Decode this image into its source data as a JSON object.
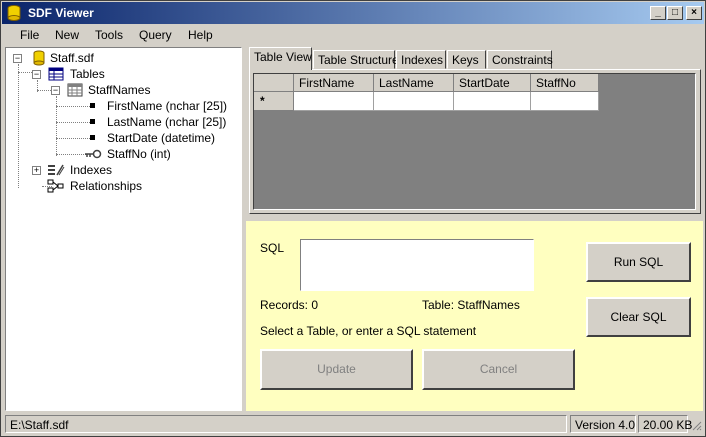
{
  "window": {
    "title": "SDF Viewer",
    "controls": {
      "minimize": "_",
      "maximize": "□",
      "close": "×"
    }
  },
  "menu": [
    "File",
    "New",
    "Tools",
    "Query",
    "Help"
  ],
  "tree": {
    "root": "Staff.sdf",
    "tables_label": "Tables",
    "table_name": "StaffNames",
    "columns": [
      "FirstName (nchar [25])",
      "LastName (nchar [25])",
      "StartDate (datetime)",
      "StaffNo (int)"
    ],
    "indexes_label": "Indexes",
    "relationships_label": "Relationships"
  },
  "tabs": [
    "Table View",
    "Table Structure",
    "Indexes",
    "Keys",
    "Constraints"
  ],
  "grid": {
    "columns": [
      "FirstName",
      "LastName",
      "StartDate",
      "StaffNo"
    ],
    "new_row_marker": "*"
  },
  "sql": {
    "label": "SQL",
    "value": "",
    "records": "Records: 0",
    "table": "Table: StaffNames",
    "hint": "Select a Table, or enter a SQL statement",
    "run_label": "Run SQL",
    "clear_label": "Clear SQL",
    "update_label": "Update",
    "cancel_label": "Cancel"
  },
  "status": {
    "path": "E:\\Staff.sdf",
    "version": "Version 4.0",
    "size": "20.00 KB"
  },
  "colors": {
    "title_start": "#0a246a",
    "title_end": "#a6caf0",
    "sql_panel_bg": "#ffffc0",
    "grid_bg": "#808080"
  }
}
